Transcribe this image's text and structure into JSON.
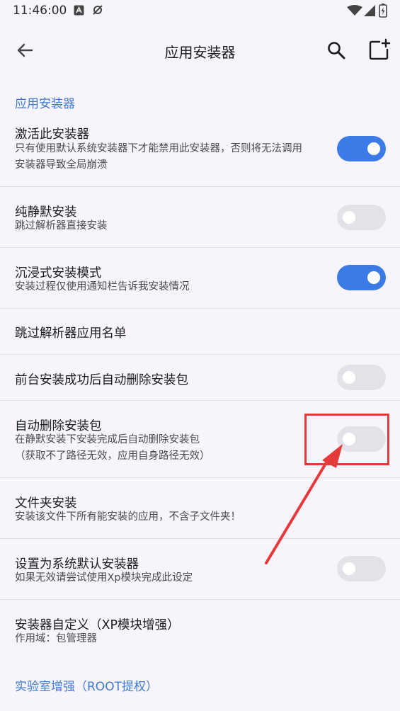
{
  "status_bar": {
    "time": "11:46:00"
  },
  "app_bar": {
    "title": "应用安装器"
  },
  "sections": [
    {
      "header": "应用安装器"
    },
    {
      "header": "实验室增强（ROOT提权）"
    }
  ],
  "settings": [
    {
      "title": "激活此安装器",
      "summary_lines": [
        "只有使用默认系统安装器下才能禁用此安装器，否则将无法调用",
        "安装器导致全局崩溃"
      ],
      "toggle": true
    },
    {
      "title": "纯静默安装",
      "summary_lines": [
        "跳过解析器直接安装"
      ],
      "toggle": false
    },
    {
      "title": "沉浸式安装模式",
      "summary_lines": [
        "安装过程仅使用通知栏告诉我安装情况"
      ],
      "toggle": true
    },
    {
      "title": "跳过解析器应用名单"
    },
    {
      "title": "前台安装成功后自动删除安装包",
      "toggle": false
    },
    {
      "title": "自动删除安装包",
      "summary_lines": [
        "在静默安装下安装完成后自动删除安装包",
        "（获取不了路径无效，应用自身路径无效）"
      ],
      "toggle": false
    },
    {
      "title": "文件夹安装",
      "summary_lines": [
        "安装该文件下所有能安装的应用，不含子文件夹！"
      ]
    },
    {
      "title": "设置为系统默认安装器",
      "summary_lines": [
        "如果无效请尝试使用Xp模块完成此设定"
      ],
      "toggle": false
    },
    {
      "title": "安装器自定义（XP模块增强）",
      "summary_lines": [
        "作用域：包管理器"
      ]
    }
  ],
  "colors": {
    "accent": "#3b7be6",
    "section_header": "#3e7ad1",
    "annotation": "#e53a3a"
  }
}
